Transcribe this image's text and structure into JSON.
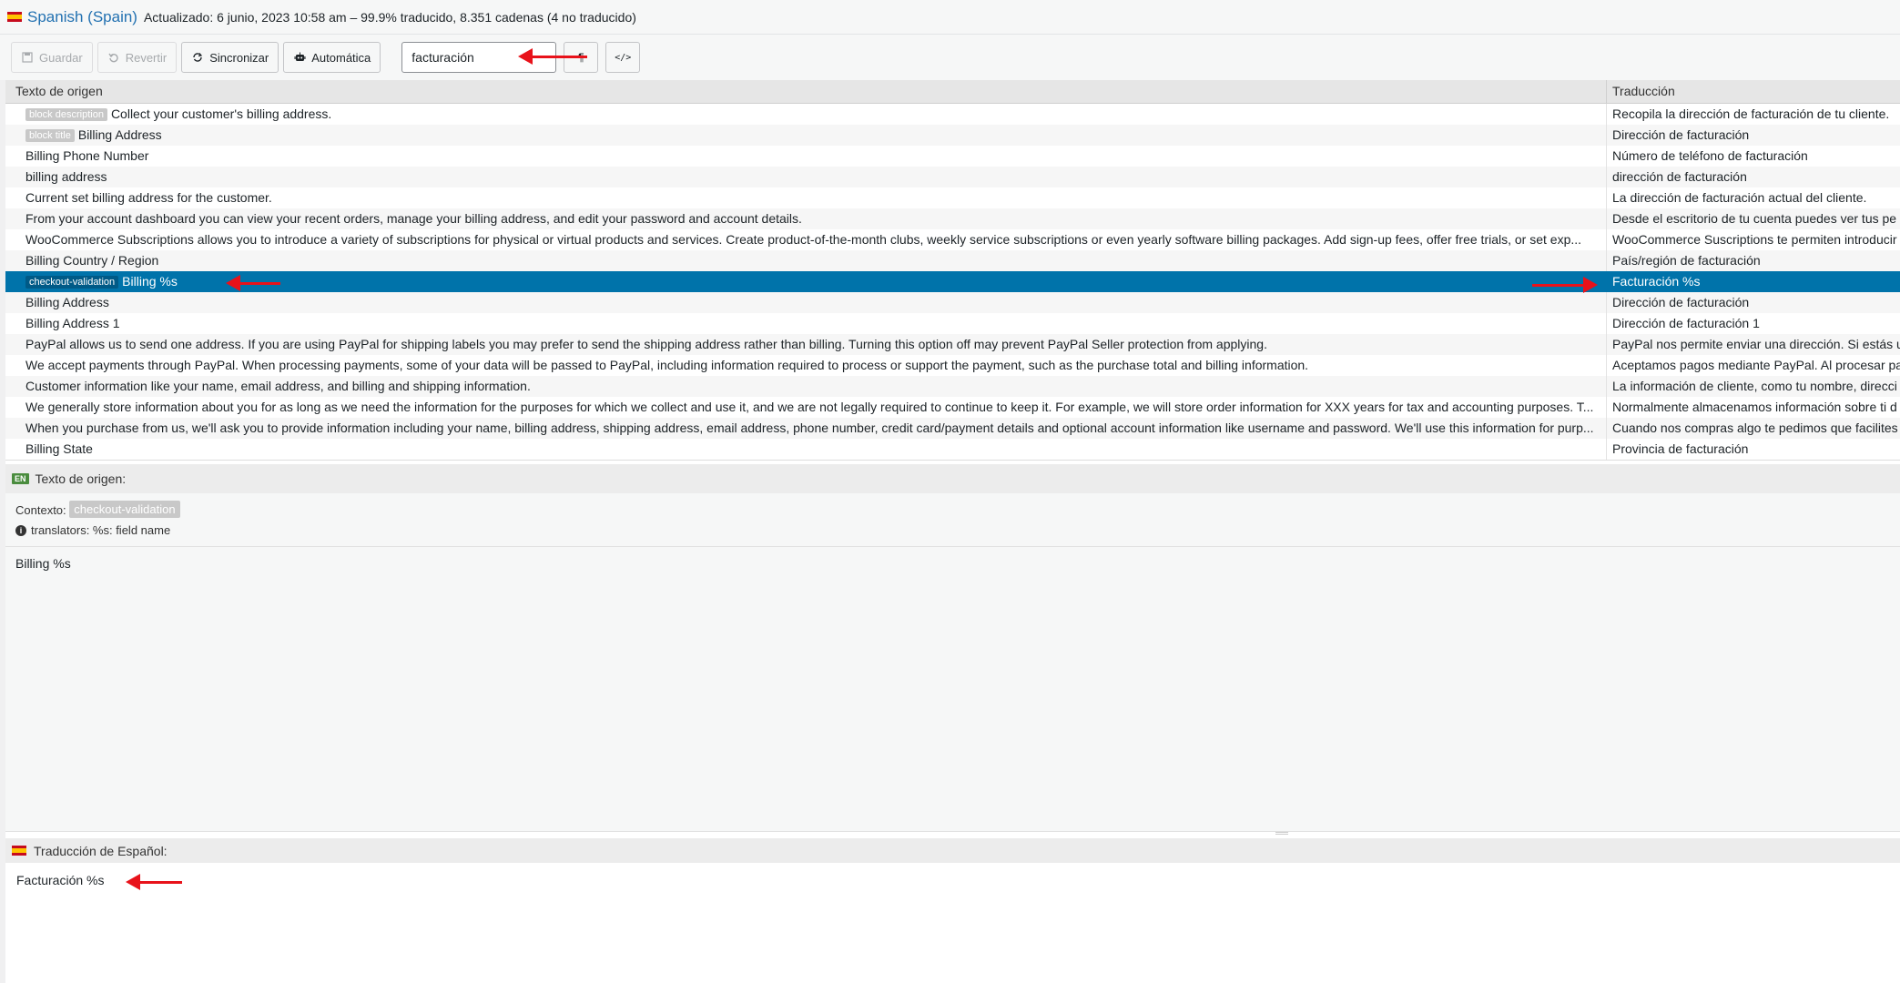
{
  "header": {
    "language": "Spanish (Spain)",
    "meta": "Actualizado: 6 junio, 2023 10:58 am – 99.9% traducido, 8.351 cadenas (4 no traducido)"
  },
  "toolbar": {
    "save_label": "Guardar",
    "revert_label": "Revertir",
    "sync_label": "Sincronizar",
    "auto_label": "Automática",
    "search_value": "facturación",
    "pilcrow_icon": "¶",
    "code_icon": "</>"
  },
  "table": {
    "col_source": "Texto de origen",
    "col_translation": "Traducción",
    "rows": [
      {
        "tag": "block description",
        "source": "Collect your customer's billing address.",
        "translation": "Recopila la dirección de facturación de tu cliente."
      },
      {
        "tag": "block title",
        "source": "Billing Address",
        "translation": "Dirección de facturación"
      },
      {
        "tag": "",
        "source": "Billing Phone Number",
        "translation": "Número de teléfono de facturación"
      },
      {
        "tag": "",
        "source": "billing address",
        "translation": "dirección de facturación"
      },
      {
        "tag": "",
        "source": "Current set billing address for the customer.",
        "translation": "La dirección de facturación actual del cliente."
      },
      {
        "tag": "",
        "source": "From your account dashboard you can view your recent orders, manage your billing address, and edit your password and account details.",
        "translation": "Desde el escritorio de tu cuenta puedes ver tus pe"
      },
      {
        "tag": "",
        "source": "WooCommerce Subscriptions allows you to introduce a variety of subscriptions for physical or virtual products and services. Create product-of-the-month clubs, weekly service subscriptions or even yearly software billing packages. Add sign-up fees, offer free trials, or set exp...",
        "translation": "WooCommerce Suscriptions te permiten introducir"
      },
      {
        "tag": "",
        "source": "Billing Country / Region",
        "translation": "País/región de facturación"
      },
      {
        "tag": "checkout-validation",
        "source": "Billing %s",
        "translation": "Facturación %s",
        "selected": true
      },
      {
        "tag": "",
        "source": "Billing Address",
        "translation": "Dirección de facturación"
      },
      {
        "tag": "",
        "source": "Billing Address 1",
        "translation": "Dirección de facturación 1"
      },
      {
        "tag": "",
        "source": "PayPal allows us to send one address. If you are using PayPal for shipping labels you may prefer to send the shipping address rather than billing. Turning this option off may prevent PayPal Seller protection from applying.",
        "translation": "PayPal nos permite enviar una dirección. Si estás u"
      },
      {
        "tag": "",
        "source": "We accept payments through PayPal. When processing payments, some of your data will be passed to PayPal, including information required to process or support the payment, such as the purchase total and billing information.",
        "translation": "Aceptamos pagos mediante PayPal. Al procesar pa"
      },
      {
        "tag": "",
        "source": "Customer information like your name, email address, and billing and shipping information.",
        "translation": "La información de cliente, como tu nombre, direcci"
      },
      {
        "tag": "",
        "source": "We generally store information about you for as long as we need the information for the purposes for which we collect and use it, and we are not legally required to continue to keep it. For example, we will store order information for XXX years for tax and accounting purposes. T...",
        "translation": "Normalmente almacenamos información sobre ti d"
      },
      {
        "tag": "",
        "source": "When you purchase from us, we'll ask you to provide information including your name, billing address, shipping address, email address, phone number, credit card/payment details and optional account information like username and password. We'll use this information for purp...",
        "translation": "Cuando nos compras algo te pedimos que facilites"
      },
      {
        "tag": "",
        "source": "Billing State",
        "translation": "Provincia de facturación"
      }
    ]
  },
  "source_panel": {
    "badge": "EN",
    "title": "Texto de origen:",
    "context_label": "Contexto:",
    "context_value": "checkout-validation",
    "note": "translators: %s: field name",
    "text": "Billing %s"
  },
  "translation_panel": {
    "title": "Traducción de Español:",
    "text": "Facturación %s"
  },
  "colors": {
    "selected_row": "#0073aa",
    "link": "#2271b1",
    "arrow": "#e8121a"
  }
}
